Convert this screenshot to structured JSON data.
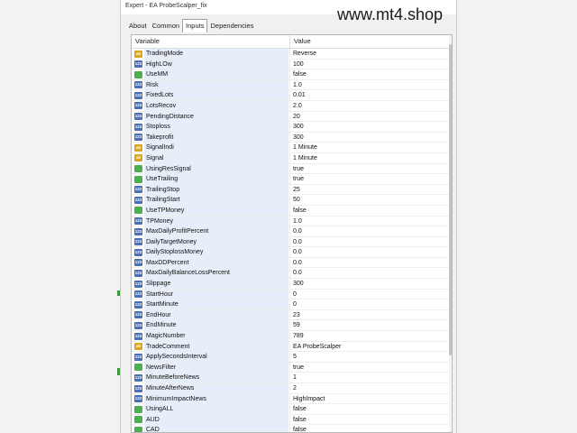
{
  "window": {
    "title": "Expert - EA ProbeScalper_fix"
  },
  "watermark": "www.mt4.shop",
  "tabs": [
    {
      "label": "About",
      "active": false
    },
    {
      "label": "Common",
      "active": false
    },
    {
      "label": "Inputs",
      "active": true
    },
    {
      "label": "Dependencies",
      "active": false
    }
  ],
  "grid": {
    "columns": [
      "Variable",
      "Value"
    ],
    "rows": [
      {
        "icon": "str-icon",
        "type": "str",
        "name": "TradingMode",
        "value": "Reverse"
      },
      {
        "icon": "num-icon",
        "type": "num",
        "name": "HighLOw",
        "value": "100"
      },
      {
        "icon": "bool-icon",
        "type": "bool",
        "name": "UseMM",
        "value": "false"
      },
      {
        "icon": "num-icon",
        "type": "num",
        "name": "Risk",
        "value": "1.0"
      },
      {
        "icon": "num-icon",
        "type": "num",
        "name": "FixedLots",
        "value": "0.01"
      },
      {
        "icon": "num-icon",
        "type": "num",
        "name": "LotsRecov",
        "value": "2.0"
      },
      {
        "icon": "num-icon",
        "type": "num",
        "name": "PendingDistance",
        "value": "20"
      },
      {
        "icon": "num-icon",
        "type": "num",
        "name": "Stoploss",
        "value": "300"
      },
      {
        "icon": "num-icon",
        "type": "num",
        "name": "Takeprofit",
        "value": "300"
      },
      {
        "icon": "str-icon",
        "type": "str",
        "name": "SignalIndi",
        "value": "1 Minute"
      },
      {
        "icon": "str-icon",
        "type": "str",
        "name": "Signal",
        "value": "1 Minute"
      },
      {
        "icon": "bool-icon",
        "type": "bool",
        "name": "UsingResSignal",
        "value": "true"
      },
      {
        "icon": "bool-icon",
        "type": "bool",
        "name": "UseTrailing",
        "value": "true"
      },
      {
        "icon": "num-icon",
        "type": "num",
        "name": "TrailingStop",
        "value": "25"
      },
      {
        "icon": "num-icon",
        "type": "num",
        "name": "TrailingStart",
        "value": "50"
      },
      {
        "icon": "bool-icon",
        "type": "bool",
        "name": "UseTPMoney",
        "value": "false"
      },
      {
        "icon": "num-icon",
        "type": "num",
        "name": "TPMoney",
        "value": "1.0"
      },
      {
        "icon": "num-icon",
        "type": "num",
        "name": "MaxDailyProfitPercent",
        "value": "0.0"
      },
      {
        "icon": "num-icon",
        "type": "num",
        "name": "DailyTargetMoney",
        "value": "0.0"
      },
      {
        "icon": "num-icon",
        "type": "num",
        "name": "DailyStoplossMoney",
        "value": "0.0"
      },
      {
        "icon": "num-icon",
        "type": "num",
        "name": "MaxDDPercent",
        "value": "0.0"
      },
      {
        "icon": "num-icon",
        "type": "num",
        "name": "MaxDailyBalanceLossPercent",
        "value": "0.0"
      },
      {
        "icon": "num-icon",
        "type": "num",
        "name": "Slippage",
        "value": "300"
      },
      {
        "icon": "num-icon",
        "type": "num",
        "name": "StartHour",
        "value": "0"
      },
      {
        "icon": "num-icon",
        "type": "num",
        "name": "StartMinute",
        "value": "0"
      },
      {
        "icon": "num-icon",
        "type": "num",
        "name": "EndHour",
        "value": "23"
      },
      {
        "icon": "num-icon",
        "type": "num",
        "name": "EndMinute",
        "value": "59"
      },
      {
        "icon": "num-icon",
        "type": "num",
        "name": "MagicNumber",
        "value": "789"
      },
      {
        "icon": "str-icon",
        "type": "str",
        "name": "TradeComment",
        "value": "EA ProbeScalper"
      },
      {
        "icon": "num-icon",
        "type": "num",
        "name": "ApplySecondsInterval",
        "value": "5"
      },
      {
        "icon": "bool-icon",
        "type": "bool",
        "name": "NewsFilter",
        "value": "true"
      },
      {
        "icon": "num-icon",
        "type": "num",
        "name": "MinuteBeforeNews",
        "value": "1"
      },
      {
        "icon": "num-icon",
        "type": "num",
        "name": "MinuteAfterNews",
        "value": "2"
      },
      {
        "icon": "num-icon",
        "type": "num",
        "name": "MinimumImpactNews",
        "value": "HighImpact"
      },
      {
        "icon": "bool-icon",
        "type": "bool",
        "name": "UsingALL",
        "value": "false"
      },
      {
        "icon": "bool-icon",
        "type": "bool",
        "name": "AUD",
        "value": "false"
      },
      {
        "icon": "bool-icon",
        "type": "bool",
        "name": "CAD",
        "value": "false"
      }
    ]
  },
  "colors": {
    "num_icon": "#4a6fb5",
    "bool_icon": "#4fae4f",
    "str_icon": "#d9a520",
    "name_highlight": "#e6eef9"
  }
}
